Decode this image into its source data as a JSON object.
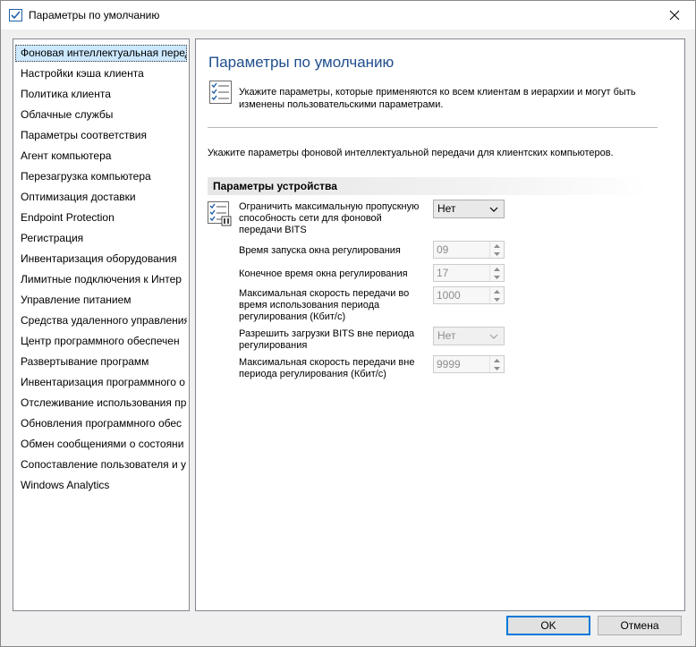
{
  "window": {
    "title": "Параметры по умолчанию",
    "icon": "checklist-icon",
    "close_icon": "close-icon"
  },
  "sidebar": {
    "items": [
      {
        "label": "Фоновая интеллектуальная перед",
        "selected": true
      },
      {
        "label": "Настройки кэша клиента"
      },
      {
        "label": "Политика клиента"
      },
      {
        "label": "Облачные службы"
      },
      {
        "label": "Параметры соответствия"
      },
      {
        "label": "Агент компьютера"
      },
      {
        "label": "Перезагрузка компьютера"
      },
      {
        "label": "Оптимизация доставки"
      },
      {
        "label": "Endpoint Protection"
      },
      {
        "label": "Регистрация"
      },
      {
        "label": "Инвентаризация оборудования"
      },
      {
        "label": "Лимитные подключения к Интер"
      },
      {
        "label": "Управление питанием"
      },
      {
        "label": "Средства удаленного управления"
      },
      {
        "label": "Центр программного обеспечен"
      },
      {
        "label": "Развертывание программ"
      },
      {
        "label": "Инвентаризация программного о"
      },
      {
        "label": "Отслеживание использования пр"
      },
      {
        "label": "Обновления программного обес"
      },
      {
        "label": "Обмен сообщениями о состояни"
      },
      {
        "label": "Сопоставление пользователя и у"
      },
      {
        "label": "Windows Analytics"
      }
    ]
  },
  "content": {
    "title": "Параметры по умолчанию",
    "intro": "Укажите параметры, которые применяются ко всем клиентам в иерархии и могут быть изменены пользовательскими параметрами.",
    "description": "Укажите параметры фоновой интеллектуальной передачи для клиентских компьютеров.",
    "group_header": "Параметры устройства",
    "settings": {
      "limit_bandwidth": {
        "label": "Ограничить максимальную пропускную способность сети для фоновой передачи BITS",
        "value": "Нет"
      },
      "window_start": {
        "label": "Время запуска окна регулирования",
        "value": "09"
      },
      "window_end": {
        "label": "Конечное время окна регулирования",
        "value": "17"
      },
      "max_rate_during": {
        "label": "Максимальная скорость передачи во время использования периода регулирования (Кбит/с)",
        "value": "1000"
      },
      "allow_outside": {
        "label": "Разрешить загрузки BITS вне периода регулирования",
        "value": "Нет"
      },
      "max_rate_outside": {
        "label": "Максимальная скорость передачи вне периода регулирования (Кбит/с)",
        "value": "9999"
      }
    }
  },
  "buttons": {
    "ok": "OK",
    "cancel": "Отмена"
  },
  "colors": {
    "title_blue": "#1f4e8c",
    "selection": "#cce8ff",
    "default_button_border": "#0078d7"
  }
}
